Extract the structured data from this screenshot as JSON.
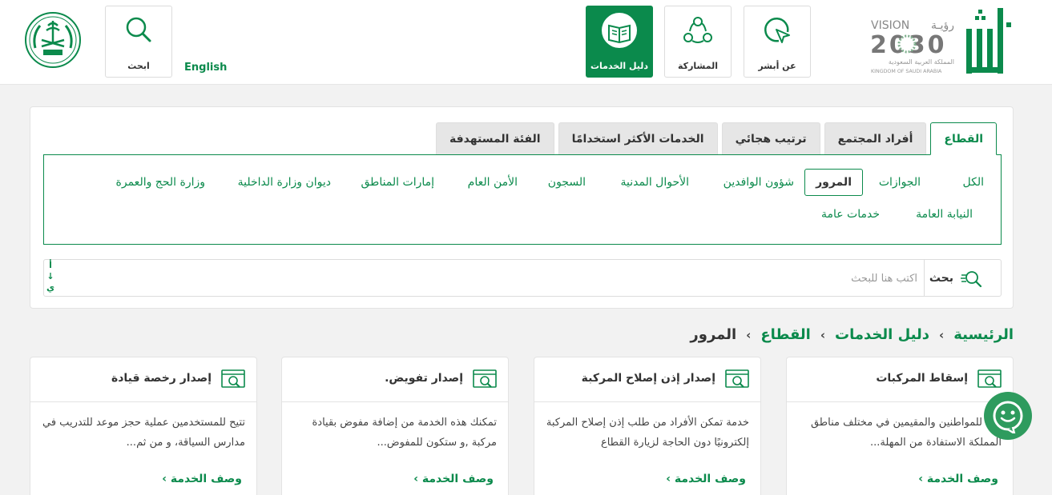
{
  "header": {
    "search_label": "ابحث",
    "language_label": "English",
    "nav": [
      {
        "label": "دليل الخدمات",
        "active": true
      },
      {
        "label": "المشاركة",
        "active": false
      },
      {
        "label": "عن أبشر",
        "active": false
      }
    ],
    "vision_top": "VISION",
    "vision_arabic": "رؤيـة",
    "vision_year": "2030",
    "vision_kingdom_ar": "المملكة العربية السعودية",
    "vision_kingdom_en": "KINGDOM OF SAUDI ARABIA"
  },
  "filters": {
    "tabs": [
      "القطاع",
      "أفراد المجتمع",
      "ترتيب هجائي",
      "الخدمات الأكثر استخدامًا",
      "الفئة المستهدفة"
    ],
    "active_tab": "القطاع",
    "sectors_row1": [
      "الكل",
      "الجوازات",
      "المرور",
      "شؤون الوافدين",
      "الأحوال المدنية",
      "السجون",
      "الأمن العام",
      "إمارات المناطق",
      "ديوان وزارة الداخلية",
      "وزارة الحج والعمرة"
    ],
    "sectors_row2": [
      "النيابة العامة",
      "خدمات عامة"
    ],
    "selected_sector": "المرور"
  },
  "search": {
    "button_label": "بحث",
    "placeholder": "اكتب هنا للبحث",
    "sort_top": "أ",
    "sort_arrow": "↓",
    "sort_bottom": "ي"
  },
  "breadcrumb": [
    "الرئيسية",
    "دليل الخدمات",
    "القطاع",
    "المرور"
  ],
  "breadcrumb_separator": "›",
  "cards": [
    {
      "title": "إسقاط المركبات",
      "desc": "تتيح للمواطنين والمقيمين في مختلف مناطق المملكة الاستفادة من المهلة...",
      "link": "وصف الخدمة ›"
    },
    {
      "title": "إصدار إذن إصلاح المركبة",
      "desc": "خدمة تمكن الأفراد من طلب إذن إصلاح المركبة إلكترونيًا دون الحاجة لزيارة القطاع",
      "link": "وصف الخدمة ›"
    },
    {
      "title": "إصدار تفويض.",
      "desc": "تمكنك هذه الخدمة من إضافة مفوض بقيادة مركبة ,و ستكون للمفوض...",
      "link": "وصف الخدمة ›"
    },
    {
      "title": "إصدار رخصة قيادة",
      "desc": "تتيح للمستخدمين عملية حجز موعد للتدريب في مدارس السياقة، و من ثم...",
      "link": "وصف الخدمة ›"
    }
  ],
  "colors": {
    "brand_green": "#0b8a4c",
    "background": "#f2f2f2"
  }
}
